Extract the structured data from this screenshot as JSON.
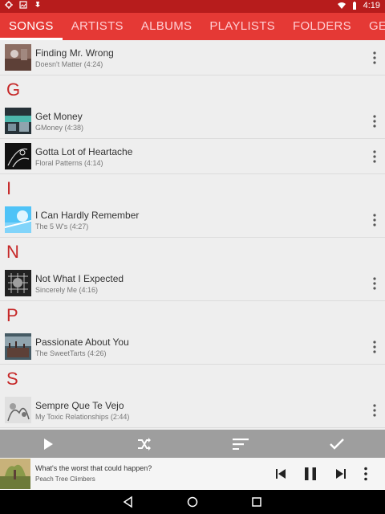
{
  "status_bar": {
    "time": "4:19"
  },
  "tabs": [
    "SONGS",
    "ARTISTS",
    "ALBUMS",
    "PLAYLISTS",
    "FOLDERS",
    "GENRES"
  ],
  "list": [
    {
      "kind": "song",
      "title": "Finding Mr. Wrong",
      "subtitle": "Doesn't Matter (4:24)"
    },
    {
      "kind": "header",
      "letter": "G"
    },
    {
      "kind": "song",
      "title": "Get Money",
      "subtitle": "GMoney (4:38)"
    },
    {
      "kind": "song",
      "title": "Gotta Lot of Heartache",
      "subtitle": "Floral Patterns (4:14)"
    },
    {
      "kind": "header",
      "letter": "I"
    },
    {
      "kind": "song",
      "title": "I Can Hardly Remember",
      "subtitle": "The 5 W's (4:27)"
    },
    {
      "kind": "header",
      "letter": "N"
    },
    {
      "kind": "song",
      "title": "Not What I Expected",
      "subtitle": "Sincerely Me (4:16)"
    },
    {
      "kind": "header",
      "letter": "P"
    },
    {
      "kind": "song",
      "title": "Passionate About You",
      "subtitle": "The SweetTarts (4:26)"
    },
    {
      "kind": "header",
      "letter": "S"
    },
    {
      "kind": "song",
      "title": "Sempre Que Te Vejo",
      "subtitle": "My Toxic Relationships (2:44)"
    }
  ],
  "action_bar": {
    "icons": [
      "play-icon",
      "shuffle-icon",
      "sort-icon",
      "check-icon"
    ]
  },
  "now_playing": {
    "title": "What's the worst that could happen?",
    "artist": "Peach Tree Climbers",
    "controls": [
      "skip-previous-icon",
      "pause-icon",
      "skip-next-icon",
      "more-vert-icon"
    ]
  },
  "nav_bar": {
    "icons": [
      "back-icon",
      "home-icon",
      "recents-icon"
    ]
  },
  "colors": {
    "accent": "#e53935",
    "status_bar": "#b71c1c",
    "section_letter": "#c62828",
    "action_bar": "#9e9e9e"
  }
}
